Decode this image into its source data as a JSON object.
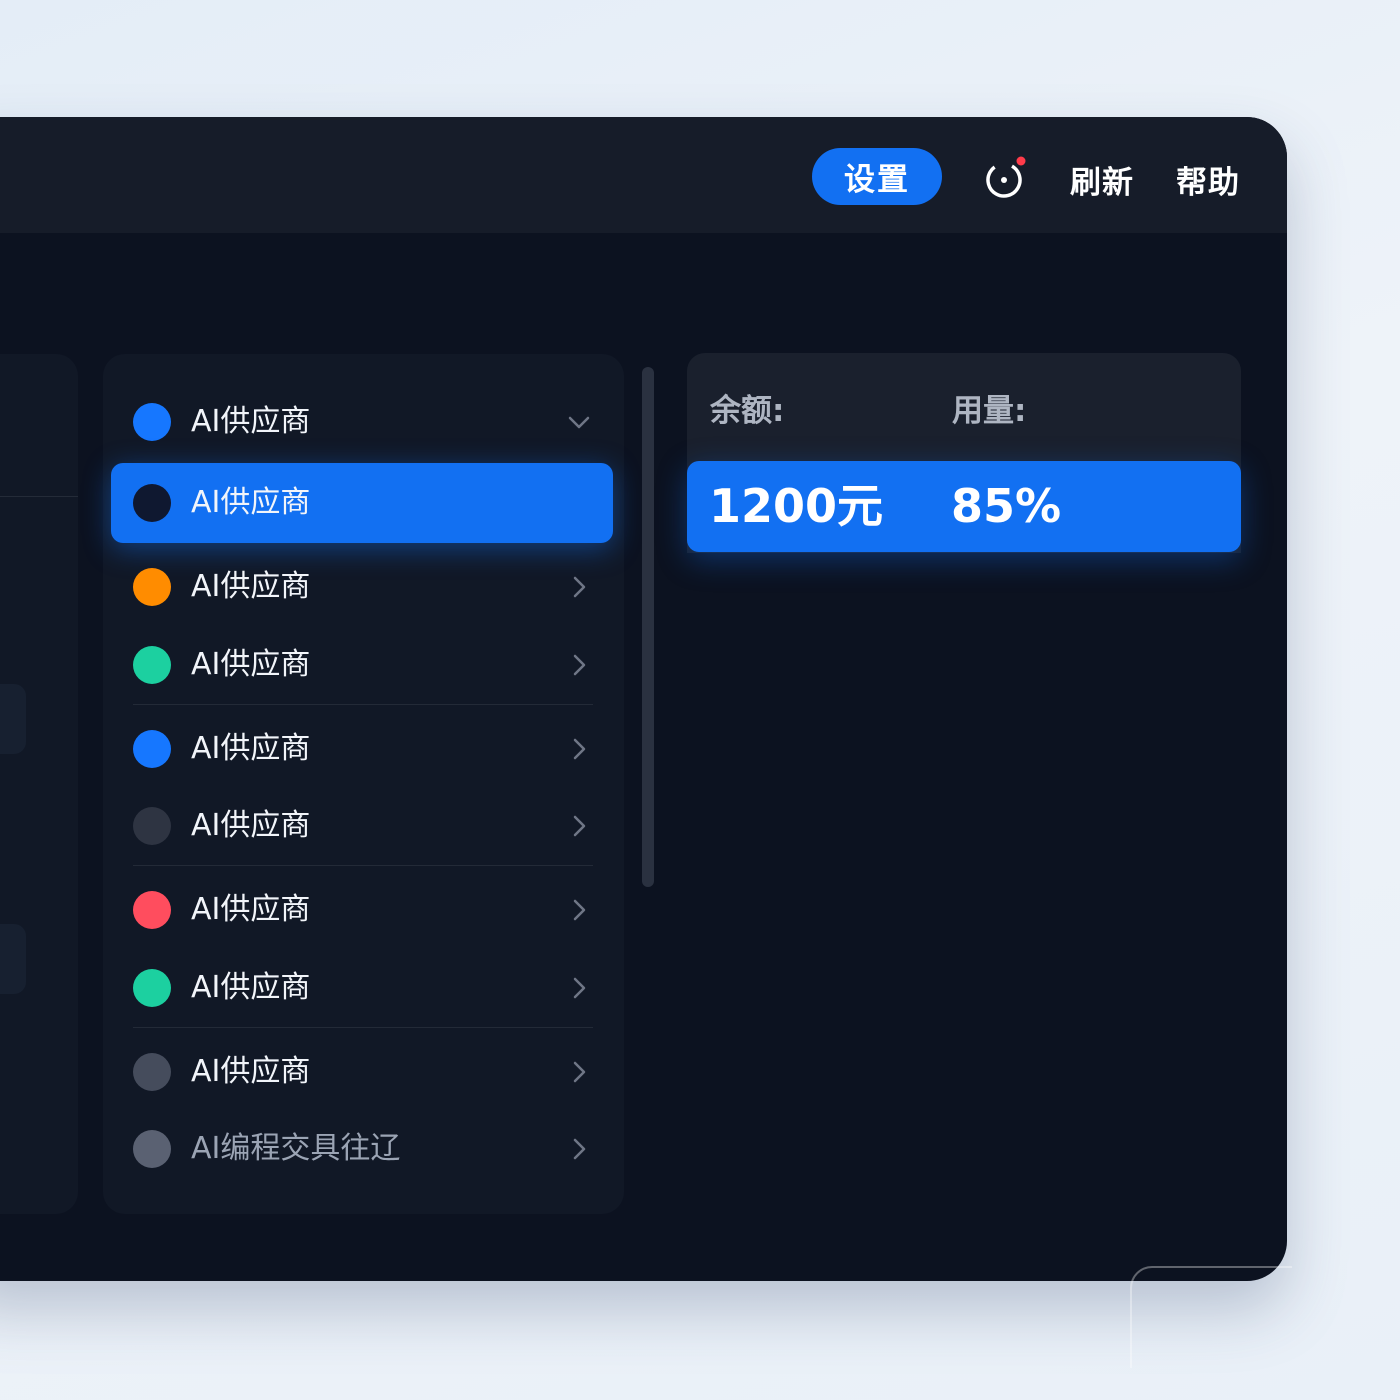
{
  "toolbar": {
    "settings_label": "设置",
    "status_icon": "status-refresh-icon",
    "refresh_label": "刷新",
    "help_label": "帮助",
    "accent": "#1270f2"
  },
  "providers": [
    {
      "label": "AI供应商",
      "color": "#1677ff",
      "selected": false,
      "chevron": "down"
    },
    {
      "label": "AI供应商",
      "color": "#0f1830",
      "selected": true,
      "chevron": "none"
    },
    {
      "label": "AI供应商",
      "color": "#ff8c00",
      "selected": false,
      "chevron": "right"
    },
    {
      "label": "AI供应商",
      "color": "#1cd0a0",
      "selected": false,
      "chevron": "right"
    },
    {
      "label": "AI供应商",
      "color": "#1677ff",
      "selected": false,
      "chevron": "right"
    },
    {
      "label": "AI供应商",
      "color": "#2e3442",
      "selected": false,
      "chevron": "right"
    },
    {
      "label": "AI供应商",
      "color": "#ff4d5e",
      "selected": false,
      "chevron": "right"
    },
    {
      "label": "AI供应商",
      "color": "#1cd0a0",
      "selected": false,
      "chevron": "right"
    },
    {
      "label": "AI供应商",
      "color": "#454c5c",
      "selected": false,
      "chevron": "right"
    },
    {
      "label": "AI编程交具往辽",
      "color": "#5a6172",
      "selected": false,
      "chevron": "right"
    }
  ],
  "balance": {
    "balance_label": "余额:",
    "usage_label": "用量:",
    "balance_value": "1200元",
    "usage_value": "85%"
  }
}
